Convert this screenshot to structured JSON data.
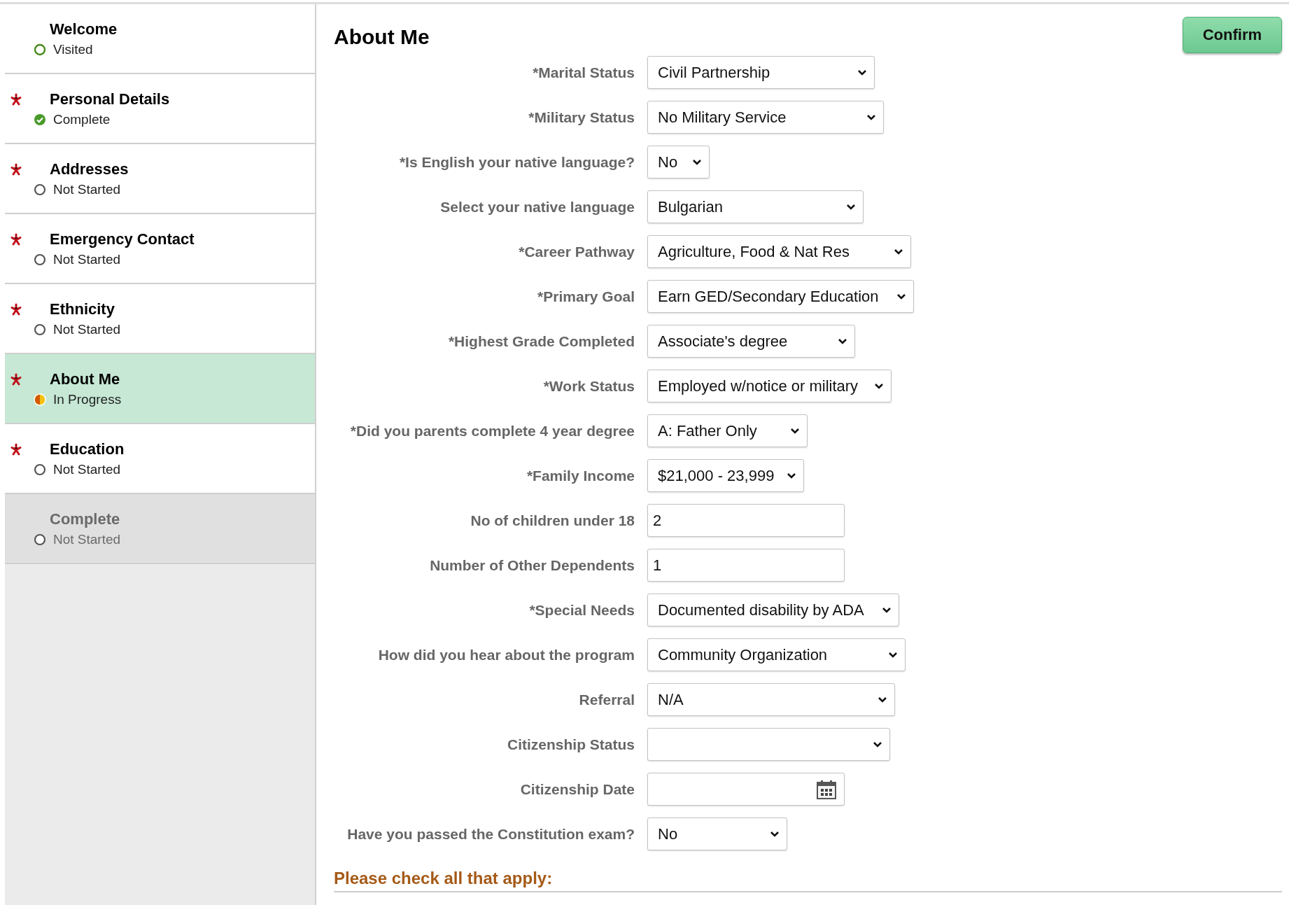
{
  "sidebar": {
    "items": [
      {
        "title": "Welcome",
        "status": "Visited",
        "kind": "visited",
        "required": false,
        "selected": false,
        "disabled": false
      },
      {
        "title": "Personal Details",
        "status": "Complete",
        "kind": "complete",
        "required": true,
        "selected": false,
        "disabled": false
      },
      {
        "title": "Addresses",
        "status": "Not Started",
        "kind": "not_started",
        "required": true,
        "selected": false,
        "disabled": false
      },
      {
        "title": "Emergency Contact",
        "status": "Not Started",
        "kind": "not_started",
        "required": true,
        "selected": false,
        "disabled": false
      },
      {
        "title": "Ethnicity",
        "status": "Not Started",
        "kind": "not_started",
        "required": true,
        "selected": false,
        "disabled": false
      },
      {
        "title": "About Me",
        "status": "In Progress",
        "kind": "in_progress",
        "required": true,
        "selected": true,
        "disabled": false
      },
      {
        "title": "Education",
        "status": "Not Started",
        "kind": "not_started",
        "required": true,
        "selected": false,
        "disabled": false
      },
      {
        "title": "Complete",
        "status": "Not Started",
        "kind": "not_started",
        "required": false,
        "selected": false,
        "disabled": true
      }
    ]
  },
  "main": {
    "title": "About Me",
    "confirm_button": "Confirm",
    "fields": [
      {
        "label": "*Marital Status",
        "kind": "select",
        "value": "Civil Partnership"
      },
      {
        "label": "*Military Status",
        "kind": "select",
        "value": "No Military Service"
      },
      {
        "label": "*Is English your native language?",
        "kind": "select",
        "value": "No"
      },
      {
        "label": "Select your native language",
        "kind": "select",
        "value": "Bulgarian"
      },
      {
        "label": "*Career Pathway",
        "kind": "select",
        "value": "Agriculture, Food & Nat Res"
      },
      {
        "label": "*Primary Goal",
        "kind": "select",
        "value": "Earn GED/Secondary Education"
      },
      {
        "label": "*Highest Grade Completed",
        "kind": "select",
        "value": "Associate's degree"
      },
      {
        "label": "*Work Status",
        "kind": "select",
        "value": "Employed w/notice or military"
      },
      {
        "label": "*Did you parents complete 4 year degree",
        "kind": "select",
        "value": "A: Father Only"
      },
      {
        "label": "*Family Income",
        "kind": "select",
        "value": "$21,000 - 23,999"
      },
      {
        "label": "No of children under 18",
        "kind": "text",
        "value": "2"
      },
      {
        "label": "Number of Other Dependents",
        "kind": "text",
        "value": "1"
      },
      {
        "label": "*Special Needs",
        "kind": "select",
        "value": "Documented disability by ADA"
      },
      {
        "label": "How did you hear about the program",
        "kind": "select",
        "value": "Community Organization"
      },
      {
        "label": "Referral",
        "kind": "select",
        "value": "N/A"
      },
      {
        "label": "Citizenship Status",
        "kind": "select"
      },
      {
        "label": "Citizenship Date",
        "kind": "date"
      },
      {
        "label": "Have you passed the Constitution exam?",
        "kind": "select",
        "value": "No"
      }
    ],
    "section_heading": "Please check all that apply:"
  }
}
